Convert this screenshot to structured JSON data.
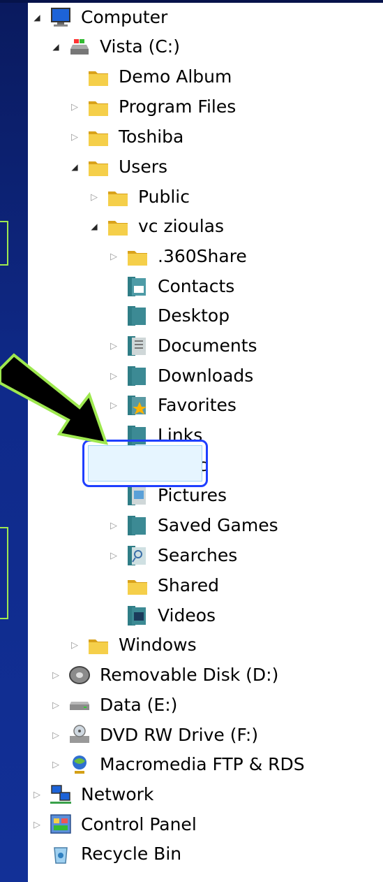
{
  "tree": {
    "items": [
      {
        "label": "Computer",
        "icon": "computer-icon",
        "expander": "open"
      },
      {
        "label": "Vista (C:)",
        "icon": "drive-icon",
        "expander": "open"
      },
      {
        "label": "Demo Album",
        "icon": "folder-icon",
        "expander": "none"
      },
      {
        "label": "Program Files",
        "icon": "folder-icon",
        "expander": "closed"
      },
      {
        "label": "Toshiba",
        "icon": "folder-icon",
        "expander": "closed"
      },
      {
        "label": "Users",
        "icon": "folder-icon",
        "expander": "open"
      },
      {
        "label": "Public",
        "icon": "folder-icon",
        "expander": "closed"
      },
      {
        "label": "vc zioulas",
        "icon": "folder-icon",
        "expander": "open"
      },
      {
        "label": ".360Share",
        "icon": "folder-icon",
        "expander": "closed"
      },
      {
        "label": "Contacts",
        "icon": "contacts-folder-icon",
        "expander": "none"
      },
      {
        "label": "Desktop",
        "icon": "desktop-folder-icon",
        "expander": "none"
      },
      {
        "label": "Documents",
        "icon": "documents-folder-icon",
        "expander": "closed"
      },
      {
        "label": "Downloads",
        "icon": "downloads-folder-icon",
        "expander": "closed"
      },
      {
        "label": "Favorites",
        "icon": "favorites-folder-icon",
        "expander": "closed"
      },
      {
        "label": "Links",
        "icon": "links-folder-icon",
        "expander": "none"
      },
      {
        "label": "Music",
        "icon": "music-folder-icon",
        "expander": "none",
        "selected": true
      },
      {
        "label": "Pictures",
        "icon": "pictures-folder-icon",
        "expander": "none"
      },
      {
        "label": "Saved Games",
        "icon": "saved-games-folder-icon",
        "expander": "closed"
      },
      {
        "label": "Searches",
        "icon": "searches-folder-icon",
        "expander": "closed"
      },
      {
        "label": "Shared",
        "icon": "folder-icon",
        "expander": "none"
      },
      {
        "label": "Videos",
        "icon": "videos-folder-icon",
        "expander": "none"
      },
      {
        "label": "Windows",
        "icon": "folder-icon",
        "expander": "closed"
      },
      {
        "label": "Removable Disk (D:)",
        "icon": "removable-disk-icon",
        "expander": "closed"
      },
      {
        "label": "Data (E:)",
        "icon": "hard-drive-icon",
        "expander": "closed"
      },
      {
        "label": "DVD RW Drive (F:)",
        "icon": "dvd-drive-icon",
        "expander": "closed"
      },
      {
        "label": "Macromedia FTP & RDS",
        "icon": "ftp-globe-icon",
        "expander": "closed"
      },
      {
        "label": "Network",
        "icon": "network-icon",
        "expander": "closed"
      },
      {
        "label": "Control Panel",
        "icon": "control-panel-icon",
        "expander": "closed"
      },
      {
        "label": "Recycle Bin",
        "icon": "recycle-bin-icon",
        "expander": "none"
      }
    ]
  },
  "colors": {
    "slide_background": "#0b1f74",
    "highlight_border": "#1f3fff",
    "arrow_outline": "#9ee84f",
    "arrow_fill": "#000000",
    "selection_fill": "#e6f5ff"
  }
}
